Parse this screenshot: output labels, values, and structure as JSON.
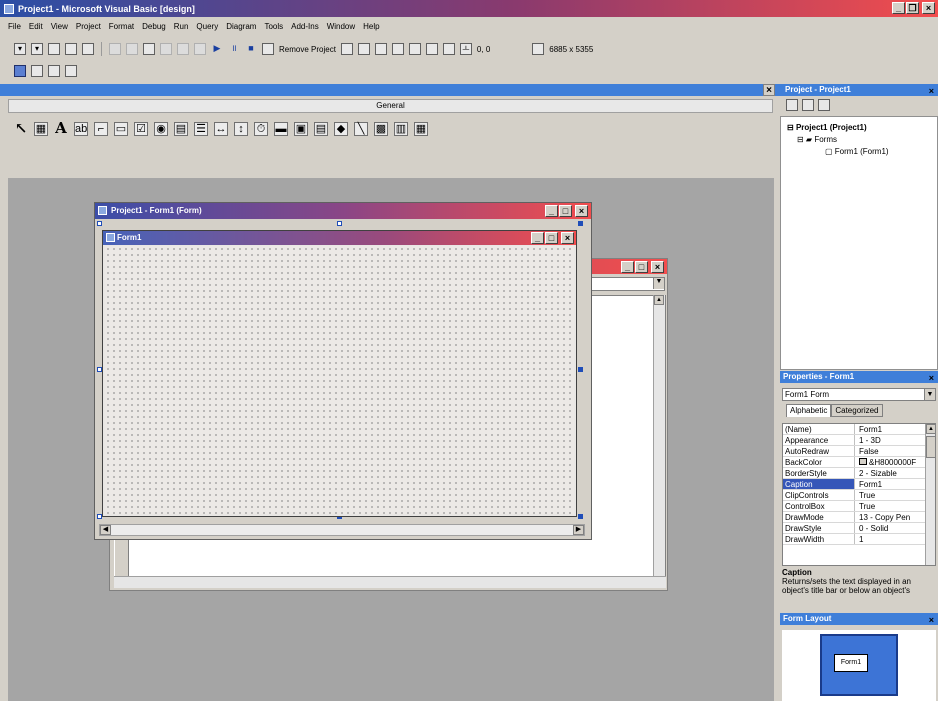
{
  "window": {
    "title": "Project1 - Microsoft Visual Basic [design]"
  },
  "menu": [
    "File",
    "Edit",
    "View",
    "Project",
    "Format",
    "Debug",
    "Run",
    "Query",
    "Diagram",
    "Tools",
    "Add-Ins",
    "Window",
    "Help"
  ],
  "toolbar": {
    "remove_project_label": "Remove Project",
    "position_readout": "0, 0",
    "size_readout": "6885 x 5355"
  },
  "general_header": "General",
  "project_explorer": {
    "title": "Project - Project1",
    "root": "Project1 (Project1)",
    "folder": "Forms",
    "item": "Form1 (Form1)"
  },
  "properties": {
    "title": "Properties - Form1",
    "object_selector": "Form1  Form",
    "tabs": [
      "Alphabetic",
      "Categorized"
    ],
    "rows": [
      {
        "name": "(Name)",
        "value": "Form1"
      },
      {
        "name": "Appearance",
        "value": "1 - 3D"
      },
      {
        "name": "AutoRedraw",
        "value": "False"
      },
      {
        "name": "BackColor",
        "value": "&H8000000F"
      },
      {
        "name": "BorderStyle",
        "value": "2 - Sizable"
      },
      {
        "name": "Caption",
        "value": "Form1"
      },
      {
        "name": "ClipControls",
        "value": "True"
      },
      {
        "name": "ControlBox",
        "value": "True"
      },
      {
        "name": "DrawMode",
        "value": "13 - Copy Pen"
      },
      {
        "name": "DrawStyle",
        "value": "0 - Solid"
      },
      {
        "name": "DrawWidth",
        "value": "1"
      }
    ],
    "description_title": "Caption",
    "description_text": "Returns/sets the text displayed in an object's title bar or below an object's"
  },
  "form_layout": {
    "title": "Form Layout",
    "form_label": "Form1"
  },
  "designer": {
    "title": "Project1 - Form1 (Form)",
    "form_caption": "Form1"
  },
  "colors": {
    "title_start": "#2b4fa6",
    "title_end": "#f24d4d",
    "pane_title": "#3f7fd9",
    "workspace": "#a5a5a5"
  }
}
